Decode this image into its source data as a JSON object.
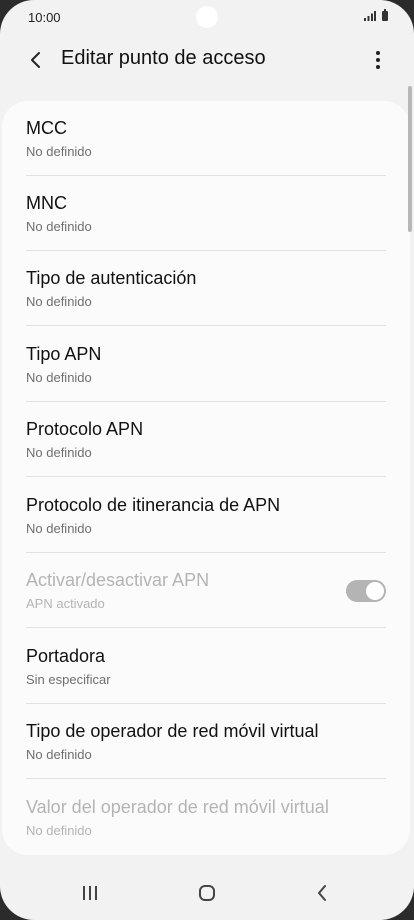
{
  "status_bar": {
    "time": "10:00",
    "icons": [
      "signal-icon",
      "battery-icon"
    ]
  },
  "app_bar": {
    "title": "Editar punto de acceso",
    "back_icon": "chevron-left-icon",
    "more_icon": "more-vert-icon"
  },
  "items": [
    {
      "title": "MCC",
      "subtitle": "No definido",
      "enabled": true
    },
    {
      "title": "MNC",
      "subtitle": "No definido",
      "enabled": true
    },
    {
      "title": "Tipo de autenticación",
      "subtitle": "No definido",
      "enabled": true
    },
    {
      "title": "Tipo APN",
      "subtitle": "No definido",
      "enabled": true
    },
    {
      "title": "Protocolo APN",
      "subtitle": "No definido",
      "enabled": true
    },
    {
      "title": "Protocolo de itinerancia de APN",
      "subtitle": "No definido",
      "enabled": true
    },
    {
      "title": "Activar/desactivar APN",
      "subtitle": "APN activado",
      "enabled": false,
      "toggle_on": true
    },
    {
      "title": "Portadora",
      "subtitle": "Sin especificar",
      "enabled": true
    },
    {
      "title": "Tipo de operador de red móvil virtual",
      "subtitle": "No definido",
      "enabled": true
    },
    {
      "title": "Valor del operador de red móvil virtual",
      "subtitle": "No definido",
      "enabled": false
    }
  ],
  "nav_bar": {
    "recent_icon": "recent-apps-icon",
    "home_icon": "home-icon",
    "back_icon": "back-icon"
  },
  "colors": {
    "background": "#f2f2f2",
    "card": "#fbfbfb",
    "text_primary": "#111111",
    "text_secondary": "#6f6f6f",
    "text_disabled": "#b4b4b4"
  }
}
